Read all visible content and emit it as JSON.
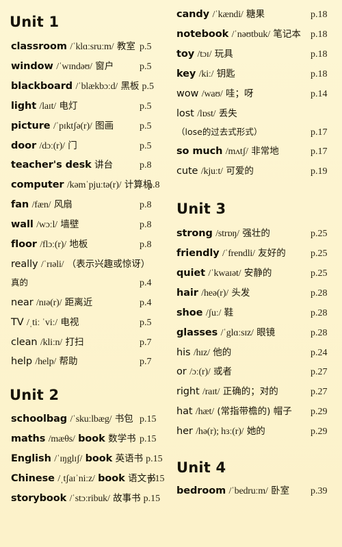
{
  "page": {
    "background_color": "#fdf5d2",
    "text_color": "#151208"
  },
  "left_column": {
    "sections": [
      {
        "heading": "Unit 1",
        "entries": [
          {
            "word": "classroom",
            "ipa": "/ˈklɑːsruːm/",
            "cn": "教室",
            "page": "p.5"
          },
          {
            "word": "window",
            "ipa": "/ˈwɪndəʊ/",
            "cn": "窗户",
            "page": "p.5"
          },
          {
            "word": "blackboard",
            "ipa": "/ˈblækbɔːd/",
            "cn": "黑板",
            "page": "p.5"
          },
          {
            "word": "light",
            "ipa": "/laɪt/",
            "cn": "电灯",
            "page": "p.5"
          },
          {
            "word": "picture",
            "ipa": "/ˈpɪktʃə(r)/",
            "cn": "图画",
            "page": "p.5"
          },
          {
            "word": "door",
            "ipa": "/dɔː(r)/",
            "cn": "门",
            "page": "p.5"
          },
          {
            "word": "teacher's desk",
            "ipa": "",
            "cn": "讲台",
            "page": "p.8"
          },
          {
            "word": "computer",
            "ipa": "/kəmˈpjuːtə(r)/",
            "cn": "计算机",
            "page": "p.8"
          },
          {
            "word": "fan",
            "ipa": "/fæn/",
            "cn": "风扇",
            "page": "p.8"
          },
          {
            "word": "wall",
            "ipa": "/wɔːl/",
            "cn": "墙壁",
            "page": "p.8"
          },
          {
            "word": "floor",
            "ipa": "/flɔː(r)/",
            "cn": "地板",
            "page": "p.8"
          },
          {
            "word": "really",
            "ipa": "/ˈrɪəli/",
            "cn": "（表示兴趣或惊讶）",
            "cn2": "真的",
            "page": "p.4",
            "two_line": true,
            "light": true
          },
          {
            "word": "near",
            "ipa": "/nɪə(r)/",
            "cn": "距离近",
            "page": "p.4",
            "light": true
          },
          {
            "word": "TV",
            "ipa": "/ˌtiː ˈviː/",
            "cn": "电视",
            "page": "p.5",
            "light": true
          },
          {
            "word": "clean",
            "ipa": "/kliːn/",
            "cn": "打扫",
            "page": "p.7",
            "light": true
          },
          {
            "word": "help",
            "ipa": "/help/",
            "cn": "帮助",
            "page": "p.7",
            "light": true
          }
        ]
      },
      {
        "heading": "Unit 2",
        "entries": [
          {
            "word": "schoolbag",
            "ipa": "/ˈskuːlbæg/",
            "cn": "书包",
            "page": "p.15"
          },
          {
            "word": "maths",
            "ipa": "/mæθs/",
            "word2": "book",
            "cn": "数学书",
            "page": "p.15"
          },
          {
            "word": "English",
            "ipa": "/ˈɪŋglɪʃ/",
            "word2": "book",
            "cn": "英语书",
            "page": "p.15"
          },
          {
            "word": "Chinese",
            "ipa": "/ˌtʃaɪˈniːz/",
            "word2": "book",
            "cn": "语文书",
            "page": "p.15"
          },
          {
            "word": "storybook",
            "ipa": "/ˈstɔːribuk/",
            "cn": "故事书",
            "page": "p.15"
          }
        ]
      }
    ]
  },
  "right_column": {
    "sections": [
      {
        "heading": "",
        "entries": [
          {
            "word": "candy",
            "ipa": "/ˈkændi/",
            "cn": "糖果",
            "page": "p.18"
          },
          {
            "word": "notebook",
            "ipa": "/ˈnəʊtbuk/",
            "cn": "笔记本",
            "page": "p.18"
          },
          {
            "word": "toy",
            "ipa": "/tɔɪ/",
            "cn": "玩具",
            "page": "p.18"
          },
          {
            "word": "key",
            "ipa": "/kiː/",
            "cn": "钥匙",
            "page": "p.18"
          },
          {
            "word": "wow",
            "ipa": "/waʊ/",
            "cn": "哇；呀",
            "page": "p.14",
            "light": true
          },
          {
            "word": "lost",
            "ipa": "/lɒst/",
            "cn": "丢失",
            "cn2": "（lose的过去式形式）",
            "page": "p.17",
            "two_line": true,
            "light": true
          },
          {
            "word": "so much",
            "ipa": "/mʌtʃ/",
            "cn": "非常地",
            "page": "p.17"
          },
          {
            "word": "cute",
            "ipa": "/kjuːt/",
            "cn": "可爱的",
            "page": "p.19",
            "light": true
          }
        ]
      },
      {
        "heading": "Unit 3",
        "entries": [
          {
            "word": "strong",
            "ipa": "/strɒŋ/",
            "cn": "强壮的",
            "page": "p.25"
          },
          {
            "word": "friendly",
            "ipa": "/ˈfrendli/",
            "cn": "友好的",
            "page": "p.25"
          },
          {
            "word": "quiet",
            "ipa": "/ˈkwaɪət/",
            "cn": "安静的",
            "page": "p.25"
          },
          {
            "word": "hair",
            "ipa": "/heə(r)/",
            "cn": "头发",
            "page": "p.28"
          },
          {
            "word": "shoe",
            "ipa": "/ʃuː/",
            "cn": "鞋",
            "page": "p.28"
          },
          {
            "word": "glasses",
            "ipa": "/ˈglɑːsɪz/",
            "cn": "眼镜",
            "page": "p.28"
          },
          {
            "word": "his",
            "ipa": "/hɪz/",
            "cn": "他的",
            "page": "p.24",
            "light": true
          },
          {
            "word": "or",
            "ipa": "/ɔː(r)/",
            "cn": "或者",
            "page": "p.27",
            "light": true
          },
          {
            "word": "right",
            "ipa": "/raɪt/",
            "cn": "正确的；对的",
            "page": "p.27",
            "light": true
          },
          {
            "word": "hat",
            "ipa": "/hæt/",
            "cn": "(常指带檐的) 帽子",
            "page": "p.29",
            "light": true
          },
          {
            "word": "her",
            "ipa": "/hə(r); hɜː(r)/",
            "cn": "她的",
            "page": "p.29",
            "light": true
          }
        ]
      },
      {
        "heading": "Unit 4",
        "entries": [
          {
            "word": "bedroom",
            "ipa": "/ˈbedruːm/",
            "cn": "卧室",
            "page": "p.39"
          }
        ]
      }
    ]
  }
}
